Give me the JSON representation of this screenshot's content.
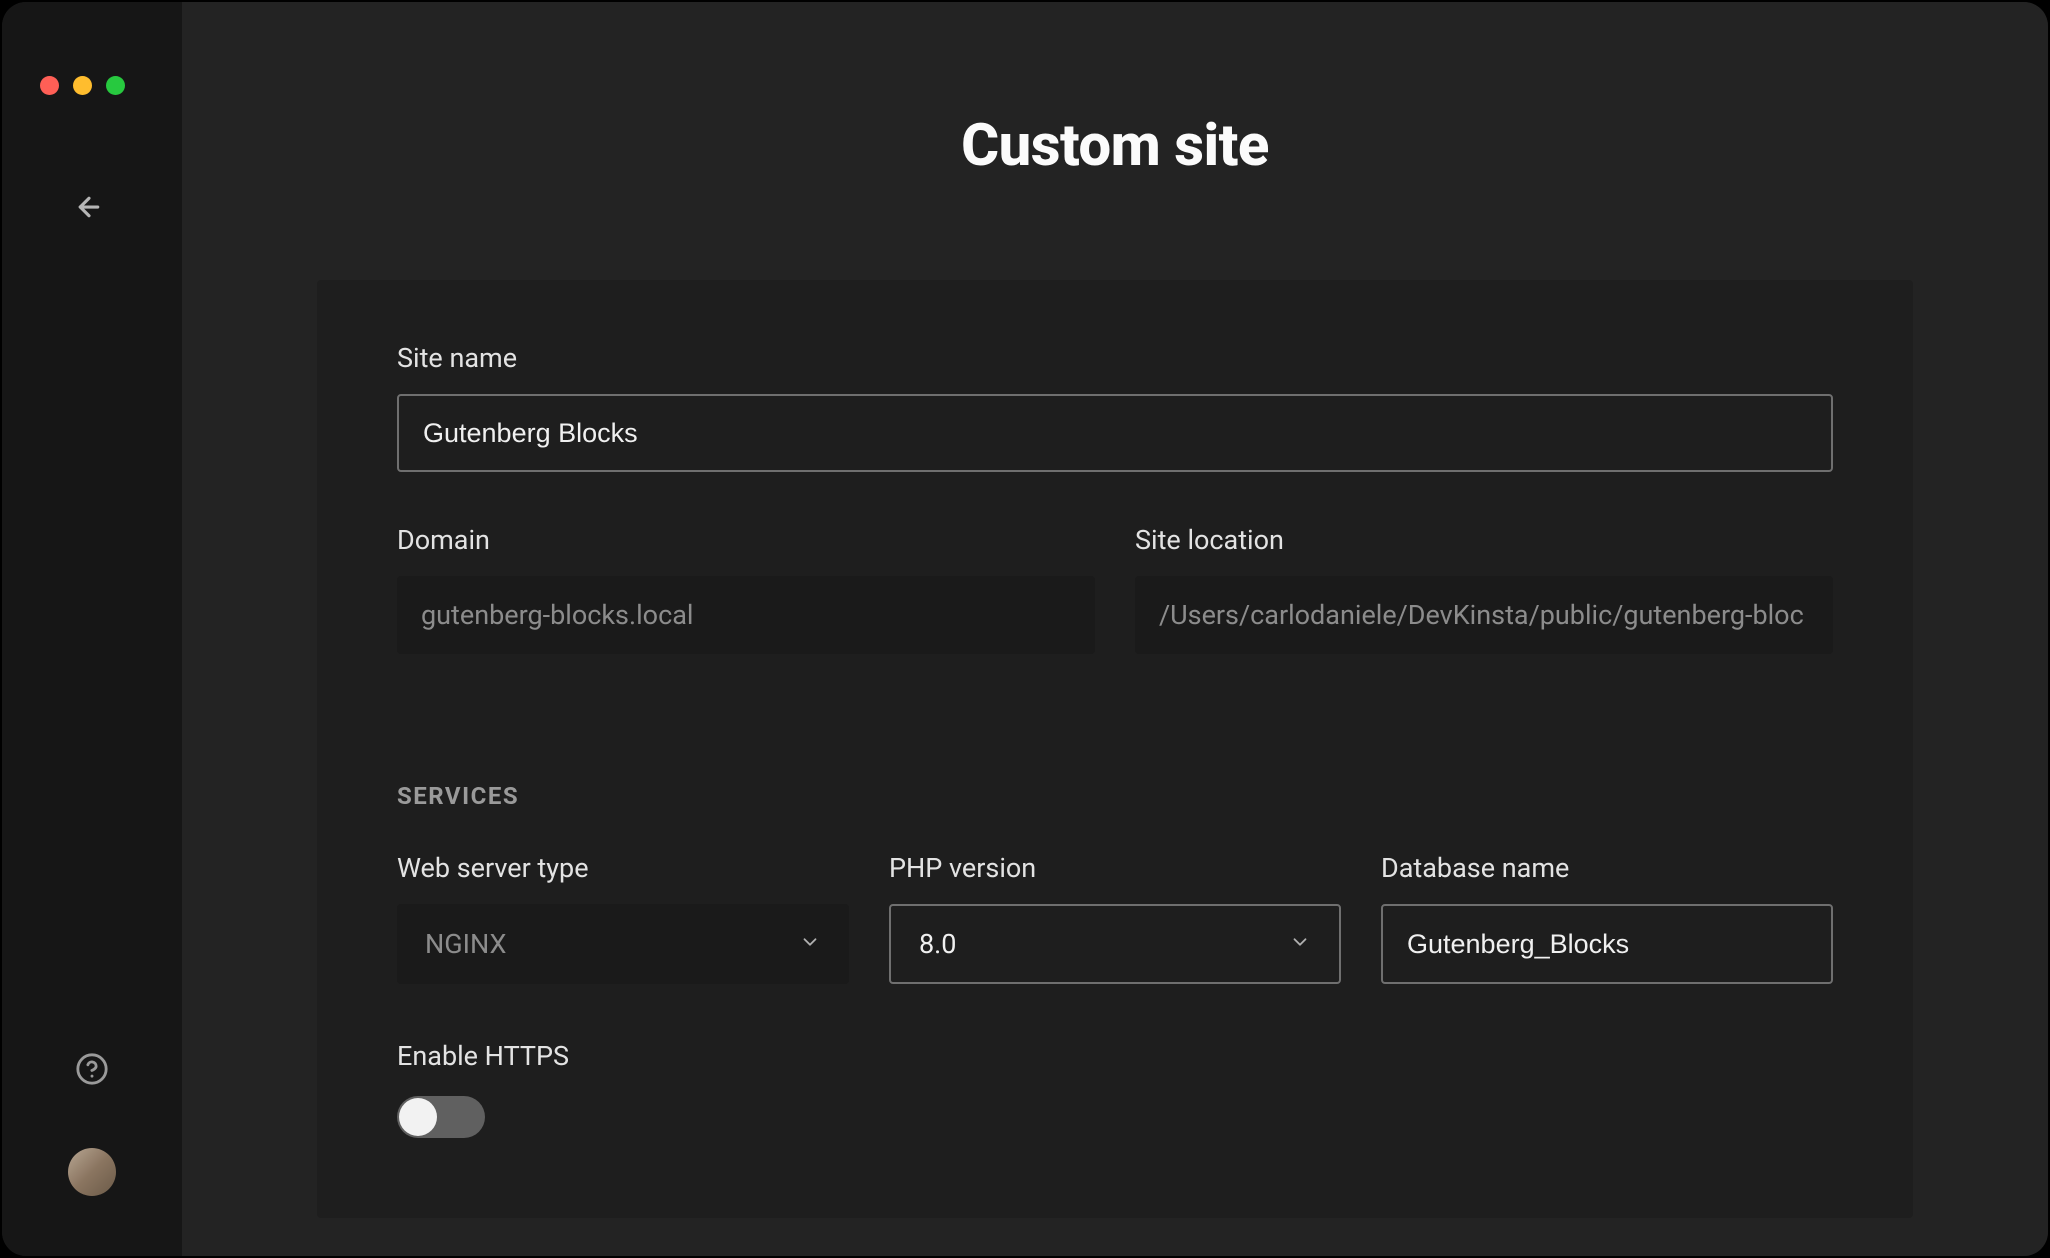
{
  "page": {
    "title": "Custom site"
  },
  "form": {
    "site_name_label": "Site name",
    "site_name_value": "Gutenberg Blocks",
    "domain_label": "Domain",
    "domain_value": "gutenberg-blocks.local",
    "site_location_label": "Site location",
    "site_location_value": "/Users/carlodaniele/DevKinsta/public/gutenberg-bloc"
  },
  "services": {
    "header": "SERVICES",
    "web_server_label": "Web server type",
    "web_server_value": "NGINX",
    "php_label": "PHP version",
    "php_value": "8.0",
    "db_label": "Database name",
    "db_value": "Gutenberg_Blocks",
    "https_label": "Enable HTTPS",
    "https_enabled": false
  }
}
